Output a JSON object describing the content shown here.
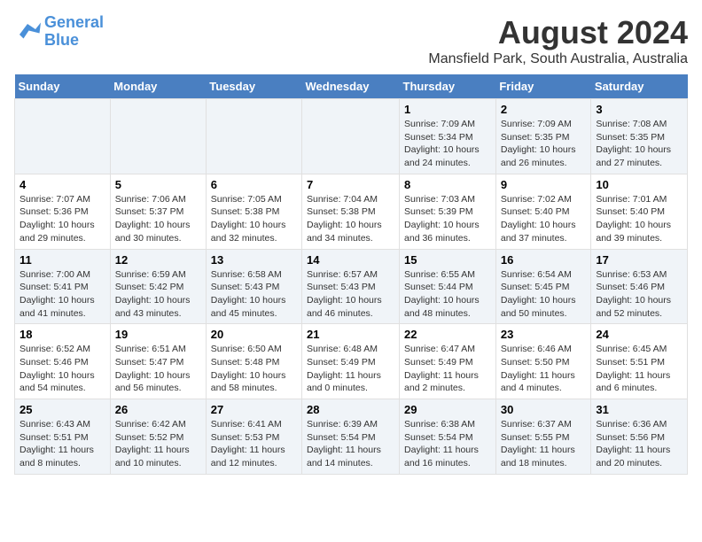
{
  "logo": {
    "line1": "General",
    "line2": "Blue"
  },
  "title": "August 2024",
  "subtitle": "Mansfield Park, South Australia, Australia",
  "headers": [
    "Sunday",
    "Monday",
    "Tuesday",
    "Wednesday",
    "Thursday",
    "Friday",
    "Saturday"
  ],
  "weeks": [
    [
      {
        "day": "",
        "info": ""
      },
      {
        "day": "",
        "info": ""
      },
      {
        "day": "",
        "info": ""
      },
      {
        "day": "",
        "info": ""
      },
      {
        "day": "1",
        "info": "Sunrise: 7:09 AM\nSunset: 5:34 PM\nDaylight: 10 hours\nand 24 minutes."
      },
      {
        "day": "2",
        "info": "Sunrise: 7:09 AM\nSunset: 5:35 PM\nDaylight: 10 hours\nand 26 minutes."
      },
      {
        "day": "3",
        "info": "Sunrise: 7:08 AM\nSunset: 5:35 PM\nDaylight: 10 hours\nand 27 minutes."
      }
    ],
    [
      {
        "day": "4",
        "info": "Sunrise: 7:07 AM\nSunset: 5:36 PM\nDaylight: 10 hours\nand 29 minutes."
      },
      {
        "day": "5",
        "info": "Sunrise: 7:06 AM\nSunset: 5:37 PM\nDaylight: 10 hours\nand 30 minutes."
      },
      {
        "day": "6",
        "info": "Sunrise: 7:05 AM\nSunset: 5:38 PM\nDaylight: 10 hours\nand 32 minutes."
      },
      {
        "day": "7",
        "info": "Sunrise: 7:04 AM\nSunset: 5:38 PM\nDaylight: 10 hours\nand 34 minutes."
      },
      {
        "day": "8",
        "info": "Sunrise: 7:03 AM\nSunset: 5:39 PM\nDaylight: 10 hours\nand 36 minutes."
      },
      {
        "day": "9",
        "info": "Sunrise: 7:02 AM\nSunset: 5:40 PM\nDaylight: 10 hours\nand 37 minutes."
      },
      {
        "day": "10",
        "info": "Sunrise: 7:01 AM\nSunset: 5:40 PM\nDaylight: 10 hours\nand 39 minutes."
      }
    ],
    [
      {
        "day": "11",
        "info": "Sunrise: 7:00 AM\nSunset: 5:41 PM\nDaylight: 10 hours\nand 41 minutes."
      },
      {
        "day": "12",
        "info": "Sunrise: 6:59 AM\nSunset: 5:42 PM\nDaylight: 10 hours\nand 43 minutes."
      },
      {
        "day": "13",
        "info": "Sunrise: 6:58 AM\nSunset: 5:43 PM\nDaylight: 10 hours\nand 45 minutes."
      },
      {
        "day": "14",
        "info": "Sunrise: 6:57 AM\nSunset: 5:43 PM\nDaylight: 10 hours\nand 46 minutes."
      },
      {
        "day": "15",
        "info": "Sunrise: 6:55 AM\nSunset: 5:44 PM\nDaylight: 10 hours\nand 48 minutes."
      },
      {
        "day": "16",
        "info": "Sunrise: 6:54 AM\nSunset: 5:45 PM\nDaylight: 10 hours\nand 50 minutes."
      },
      {
        "day": "17",
        "info": "Sunrise: 6:53 AM\nSunset: 5:46 PM\nDaylight: 10 hours\nand 52 minutes."
      }
    ],
    [
      {
        "day": "18",
        "info": "Sunrise: 6:52 AM\nSunset: 5:46 PM\nDaylight: 10 hours\nand 54 minutes."
      },
      {
        "day": "19",
        "info": "Sunrise: 6:51 AM\nSunset: 5:47 PM\nDaylight: 10 hours\nand 56 minutes."
      },
      {
        "day": "20",
        "info": "Sunrise: 6:50 AM\nSunset: 5:48 PM\nDaylight: 10 hours\nand 58 minutes."
      },
      {
        "day": "21",
        "info": "Sunrise: 6:48 AM\nSunset: 5:49 PM\nDaylight: 11 hours\nand 0 minutes."
      },
      {
        "day": "22",
        "info": "Sunrise: 6:47 AM\nSunset: 5:49 PM\nDaylight: 11 hours\nand 2 minutes."
      },
      {
        "day": "23",
        "info": "Sunrise: 6:46 AM\nSunset: 5:50 PM\nDaylight: 11 hours\nand 4 minutes."
      },
      {
        "day": "24",
        "info": "Sunrise: 6:45 AM\nSunset: 5:51 PM\nDaylight: 11 hours\nand 6 minutes."
      }
    ],
    [
      {
        "day": "25",
        "info": "Sunrise: 6:43 AM\nSunset: 5:51 PM\nDaylight: 11 hours\nand 8 minutes."
      },
      {
        "day": "26",
        "info": "Sunrise: 6:42 AM\nSunset: 5:52 PM\nDaylight: 11 hours\nand 10 minutes."
      },
      {
        "day": "27",
        "info": "Sunrise: 6:41 AM\nSunset: 5:53 PM\nDaylight: 11 hours\nand 12 minutes."
      },
      {
        "day": "28",
        "info": "Sunrise: 6:39 AM\nSunset: 5:54 PM\nDaylight: 11 hours\nand 14 minutes."
      },
      {
        "day": "29",
        "info": "Sunrise: 6:38 AM\nSunset: 5:54 PM\nDaylight: 11 hours\nand 16 minutes."
      },
      {
        "day": "30",
        "info": "Sunrise: 6:37 AM\nSunset: 5:55 PM\nDaylight: 11 hours\nand 18 minutes."
      },
      {
        "day": "31",
        "info": "Sunrise: 6:36 AM\nSunset: 5:56 PM\nDaylight: 11 hours\nand 20 minutes."
      }
    ]
  ]
}
